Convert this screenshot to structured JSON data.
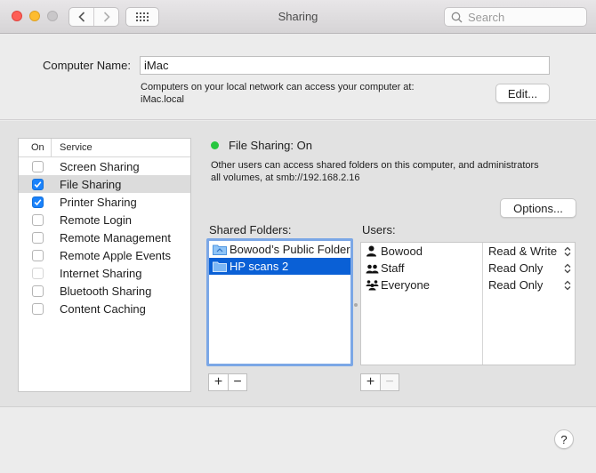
{
  "window": {
    "title": "Sharing"
  },
  "toolbar": {
    "back_icon": "chevron-left",
    "forward_icon": "chevron-right",
    "show_all_icon": "grid"
  },
  "search": {
    "placeholder": "Search"
  },
  "computer": {
    "label": "Computer Name:",
    "value": "iMac",
    "info_line1": "Computers on your local network can access your computer at:",
    "info_line2": "iMac.local",
    "edit_label": "Edit..."
  },
  "services": {
    "header_on": "On",
    "header_service": "Service",
    "items": [
      {
        "label": "Screen Sharing",
        "checked": false,
        "selected": false,
        "enabled": true
      },
      {
        "label": "File Sharing",
        "checked": true,
        "selected": true,
        "enabled": true
      },
      {
        "label": "Printer Sharing",
        "checked": true,
        "selected": false,
        "enabled": true
      },
      {
        "label": "Remote Login",
        "checked": false,
        "selected": false,
        "enabled": true
      },
      {
        "label": "Remote Management",
        "checked": false,
        "selected": false,
        "enabled": true
      },
      {
        "label": "Remote Apple Events",
        "checked": false,
        "selected": false,
        "enabled": true
      },
      {
        "label": "Internet Sharing",
        "checked": false,
        "selected": false,
        "enabled": false
      },
      {
        "label": "Bluetooth Sharing",
        "checked": false,
        "selected": false,
        "enabled": true
      },
      {
        "label": "Content Caching",
        "checked": false,
        "selected": false,
        "enabled": true
      }
    ]
  },
  "status": {
    "text": "File Sharing: On",
    "color": "#27c63f",
    "desc_line1": "Other users can access shared folders on this computer, and administrators",
    "desc_line2": "all volumes, at smb://192.168.2.16"
  },
  "options_label": "Options...",
  "shared_folders": {
    "label": "Shared Folders:",
    "items": [
      {
        "label": "Bowood’s Public Folder",
        "selected": false
      },
      {
        "label": "HP scans 2",
        "selected": true
      }
    ]
  },
  "users": {
    "label": "Users:",
    "items": [
      {
        "name": "Bowood",
        "permission": "Read & Write",
        "icon": "single-user"
      },
      {
        "name": "Staff",
        "permission": "Read Only",
        "icon": "group"
      },
      {
        "name": "Everyone",
        "permission": "Read Only",
        "icon": "everyone"
      }
    ]
  },
  "add_remove": {
    "add": "+",
    "remove": "−"
  },
  "help_label": "?",
  "colors": {
    "accent": "#1a82fb",
    "selection": "#0a60d6",
    "focus_ring": "#7ba7e6"
  }
}
